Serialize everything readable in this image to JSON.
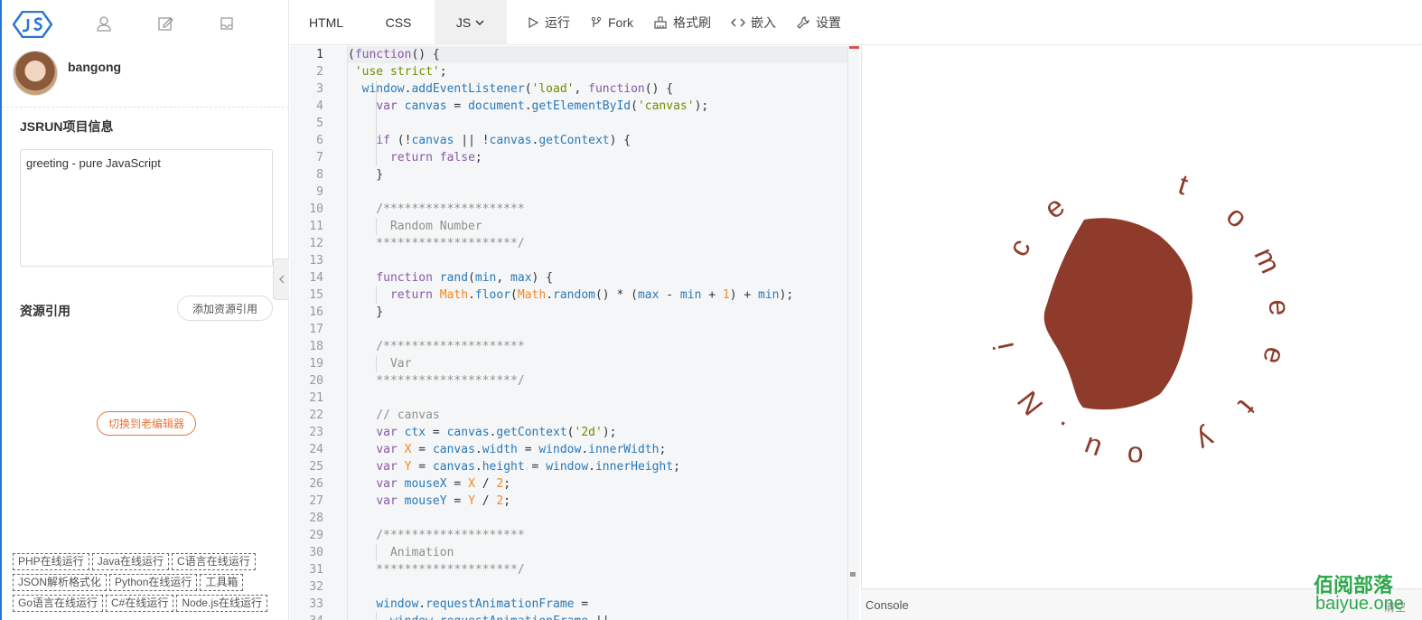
{
  "sidebar": {
    "username": "bangong",
    "project_title": "JSRUN项目信息",
    "project_description": "greeting - pure JavaScript",
    "resources_title": "资源引用",
    "add_resource_label": "添加资源引用",
    "switch_editor_label": "切换到老编辑器",
    "tags": [
      "PHP在线运行",
      "Java在线运行",
      "C语言在线运行",
      "JSON解析格式化",
      "Python在线运行",
      "工具箱",
      "Go语言在线运行",
      "C#在线运行",
      "Node.js在线运行"
    ]
  },
  "toolbar": {
    "tab_html": "HTML",
    "tab_css": "CSS",
    "tab_js": "JS",
    "run_label": "运行",
    "fork_label": "Fork",
    "format_label": "格式刷",
    "embed_label": "嵌入",
    "settings_label": "设置"
  },
  "editor": {
    "line_numbers": [
      "1",
      "2",
      "3",
      "4",
      "5",
      "6",
      "7",
      "8",
      "9",
      "10",
      "11",
      "12",
      "13",
      "14",
      "15",
      "16",
      "17",
      "18",
      "19",
      "20",
      "21",
      "22",
      "23",
      "24",
      "25",
      "26",
      "27",
      "28",
      "29",
      "30",
      "31",
      "32",
      "33",
      "34"
    ],
    "lines": [
      "(function() {",
      " 'use strict';",
      "  window.addEventListener('load', function() {",
      "    var canvas = document.getElementById('canvas');",
      "",
      "    if (!canvas || !canvas.getContext) {",
      "      return false;",
      "    }",
      "",
      "    /********************",
      "      Random Number",
      "    ********************/",
      "",
      "    function rand(min, max) {",
      "      return Math.floor(Math.random() * (max - min + 1) + min);",
      "    }",
      "",
      "    /********************",
      "      Var",
      "    ********************/",
      "",
      "    // canvas",
      "    var ctx = canvas.getContext('2d');",
      "    var X = canvas.width = window.innerWidth;",
      "    var Y = canvas.height = window.innerHeight;",
      "    var mouseX = X / 2;",
      "    var mouseY = Y / 2;",
      "",
      "    /********************",
      "      Animation",
      "    ********************/",
      "",
      "    window.requestAnimationFrame =",
      "      window.requestAnimationFrame ||"
    ]
  },
  "preview": {
    "circle_letters": [
      "N",
      "i",
      "c",
      "e",
      "t",
      "o",
      "m",
      "e",
      "e",
      "t",
      "y",
      "o",
      "u",
      "."
    ],
    "blob_color": "#8e3b2b",
    "text_color": "#8e3b2b"
  },
  "console": {
    "label": "Console",
    "clear_label": "清空"
  },
  "watermark": {
    "line1": "佰阅部落",
    "line2": "baiyue.one"
  }
}
